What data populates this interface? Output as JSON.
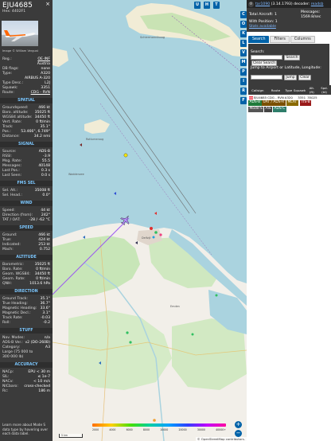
{
  "panel": {
    "callsign": "EJU4685",
    "hex_line": "Hex: 4402F1",
    "close_glyph": "×",
    "photo_credit": "Image © William Vergust",
    "info": [
      {
        "k": "Reg.:",
        "v": "OE-INF",
        "link": true
      },
      {
        "k": "",
        "v": "Austria"
      },
      {
        "k": "DB flags:",
        "v": "none"
      },
      {
        "k": "Type:",
        "v": "A320"
      },
      {
        "k": "",
        "v": "AIRBUS A-320"
      },
      {
        "k": "Type Desc.:",
        "v": "L2J"
      },
      {
        "k": "Squawk:",
        "v": "3351"
      },
      {
        "k": "Route:",
        "v": "CDG - RVN",
        "link": true
      }
    ],
    "spatial_title": "SPATIAL",
    "spatial": [
      {
        "k": "Groundspeed:",
        "v": "466 kt"
      },
      {
        "k": "Baro. altitude:",
        "v": "35025 ft"
      },
      {
        "k": "WGS84 altitude:",
        "v": "34450 ft"
      },
      {
        "k": "Vert. Rate:",
        "v": "0 ft/min"
      },
      {
        "k": "Track:",
        "v": "35.1°"
      },
      {
        "k": "Pos.:",
        "v": "53.466°, 6.749°"
      },
      {
        "k": "Distance:",
        "v": "34.2 nmi"
      }
    ],
    "signal_title": "SIGNAL",
    "signal": [
      {
        "k": "Source:",
        "v": "ADS-B"
      },
      {
        "k": "RSSI:",
        "v": "-3.9"
      },
      {
        "k": "Msg. Rate:",
        "v": "55.5"
      },
      {
        "k": "Messages:",
        "v": "40148"
      },
      {
        "k": "Last Pos.:",
        "v": "0.3 s"
      },
      {
        "k": "Last Seen:",
        "v": "0.0 s"
      }
    ],
    "fms_title": "FMS SEL",
    "fms": [
      {
        "k": "Sel. Alt.:",
        "v": "35008 ft"
      },
      {
        "k": "Sel. Head.:",
        "v": "0.0°"
      }
    ],
    "wind_title": "WIND",
    "wind": [
      {
        "k": "Speed:",
        "v": "44 kt"
      },
      {
        "k": "Direction (from):",
        "v": "242°"
      },
      {
        "k": "TAT / OAT:",
        "v": "-28 / -62 °C"
      }
    ],
    "speed_title": "SPEED",
    "speed": [
      {
        "k": "Ground:",
        "v": "466 kt"
      },
      {
        "k": "True:",
        "v": "424 kt"
      },
      {
        "k": "Indicated:",
        "v": "253 kt"
      },
      {
        "k": "Mach:",
        "v": "0.752"
      }
    ],
    "altitude_title": "ALTITUDE",
    "altitude": [
      {
        "k": "Barometric:",
        "v": "35025 ft"
      },
      {
        "k": "Baro. Rate:",
        "v": "0 ft/min"
      },
      {
        "k": "Geom. WGS84:",
        "v": "34450 ft"
      },
      {
        "k": "Geom. Rate:",
        "v": "0 ft/min"
      },
      {
        "k": "QNH:",
        "v": "1013.6 hPa"
      }
    ],
    "direction_title": "DIRECTION",
    "direction": [
      {
        "k": "Ground Track:",
        "v": "35.1°"
      },
      {
        "k": "True Heading:",
        "v": "36.7°"
      },
      {
        "k": "Magnetic Heading:",
        "v": "33.6°"
      },
      {
        "k": "Magnetic Decl.:",
        "v": "3.1°"
      },
      {
        "k": "Track Rate:",
        "v": "-0.03"
      },
      {
        "k": "Roll:",
        "v": "-0.2"
      }
    ],
    "stuff_title": "STUFF",
    "stuff": [
      {
        "k": "Nav. Modes:",
        "v": "n/a"
      },
      {
        "k": "ADS-B Ver.:",
        "v": "v2 (DO-260B)"
      },
      {
        "k": "Category:",
        "v": "A3"
      },
      {
        "k": "Large (75 000 to",
        "v": ""
      },
      {
        "k": "300 000 lb)",
        "v": ""
      }
    ],
    "accuracy_title": "ACCURACY",
    "accuracy": [
      {
        "k": "NACp:",
        "v": "EPU < 30 m"
      },
      {
        "k": "SIL:",
        "v": "≤ 1e-7"
      },
      {
        "k": "NACv:",
        "v": "< 10 m/s"
      },
      {
        "k": "NICbaro:",
        "v": "cross-checked"
      },
      {
        "k": "Rc:",
        "v": "186 m"
      }
    ],
    "footer": "Learn more about Mode S data type by hovering over each data label."
  },
  "map": {
    "buttons_top": [
      "U",
      "H",
      "T"
    ],
    "buttons_side": [
      "C",
      "O",
      "K",
      "L",
      "V",
      "M",
      "P",
      "I",
      "R",
      "F"
    ],
    "zoom_in": "+",
    "zoom_out": "−",
    "scale_label": "5 km",
    "altitude_legend": [
      "2000",
      "4000",
      "6000",
      "8000",
      "10000",
      "20000",
      "30000",
      "40000+"
    ],
    "attribution": "© OpenStreetMap contributors."
  },
  "right": {
    "version_link": "tar1090",
    "version": "(3.14.1793)",
    "decoder_label": "decoder:",
    "decoder_link": "readsb",
    "total_aircraft": "Total Aircraft: 1",
    "messages_label": "Messages:",
    "messages_rate": "1569.8/sec",
    "with_position": "With Position: 1",
    "stats_available": "Stats available",
    "tabs": [
      "Search",
      "Filters",
      "Columns"
    ],
    "search_label": "Search:",
    "search_button": "Search",
    "clear_search": "Clear Search",
    "jump_label": "Jump to Airport or Latitude, Longitude:",
    "jump_button": "Jump",
    "clear_button": "Clear",
    "table_headers": [
      "Callsign",
      "Route",
      "Type",
      "Squawk",
      "Alt. (ft)",
      "Spd. (kt)"
    ],
    "rows": [
      {
        "callsign": "EJU4685",
        "route": "CDG - RVN",
        "type": "A320",
        "squawk": "3351",
        "alt": "35025",
        "spd": ""
      }
    ],
    "source_chips": [
      {
        "label": "ADS-B",
        "color": "#1f7a3a"
      },
      {
        "label": "UAT / ADS-R",
        "color": "#7a4f00"
      },
      {
        "label": "MLAT",
        "color": "#8a6a00"
      },
      {
        "label": "TIS-B",
        "color": "#9a1a1a"
      }
    ],
    "source_chips_2": [
      {
        "label": "Mode-S",
        "color": "#555555"
      },
      {
        "label": "AIS",
        "color": "#444444"
      },
      {
        "label": "ADS-C",
        "color": "#2e7d6a"
      }
    ]
  }
}
